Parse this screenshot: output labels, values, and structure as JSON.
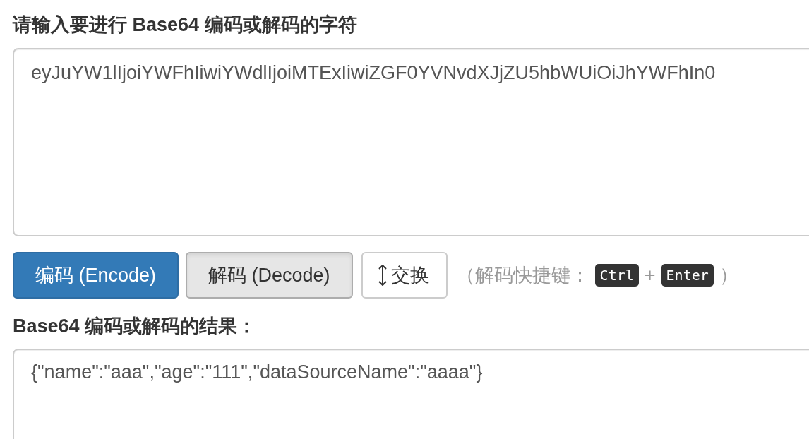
{
  "input_section": {
    "label": "请输入要进行 Base64 编码或解码的字符",
    "textarea": {
      "value": "eyJuYW1lIjoiYWFhIiwiYWdlIjoiMTExIiwiZGF0YVNvdXJjZU5hbWUiOiJhYWFhIn0"
    }
  },
  "buttons": [
    {
      "label": "编码 (Encode)",
      "kind": "primary",
      "pressed": false
    },
    {
      "label": "解码 (Decode)",
      "kind": "secondary",
      "pressed": true
    },
    {
      "label": "交换",
      "kind": "swap",
      "pressed": false
    }
  ],
  "shortcut_hint": {
    "open": "（解码快捷键：",
    "keys": [
      "Ctrl",
      "Enter"
    ],
    "separator": "+",
    "close": "）"
  },
  "output_section": {
    "label": "Base64 编码或解码的结果：",
    "textarea": {
      "value": "{\"name\":\"aaa\",\"age\":\"111\",\"dataSourceName\":\"aaaa\"}"
    }
  }
}
